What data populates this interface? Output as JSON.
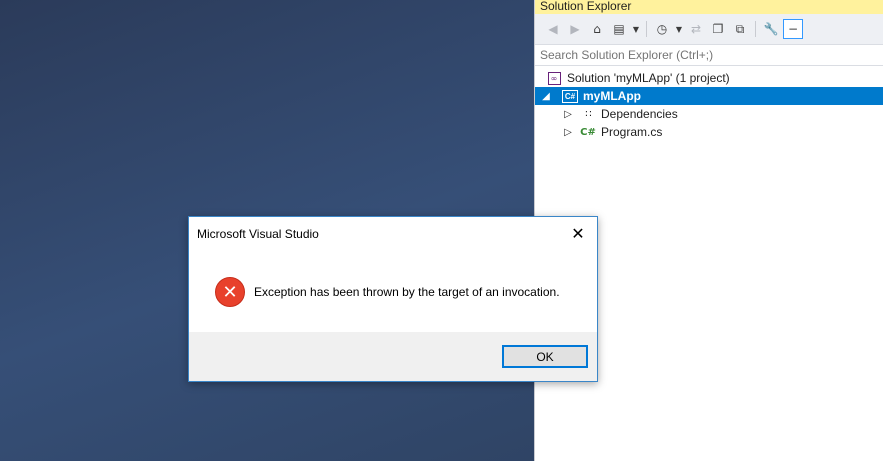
{
  "solution_explorer": {
    "title": "Solution Explorer",
    "search_placeholder": "Search Solution Explorer (Ctrl+;)",
    "tree": {
      "solution_label": "Solution 'myMLApp' (1 project)",
      "project_label": "myMLApp",
      "dependencies_label": "Dependencies",
      "program_label": "Program.cs"
    }
  },
  "dialog": {
    "title": "Microsoft Visual Studio",
    "message": "Exception has been thrown by the target of an invocation.",
    "ok_label": "OK"
  },
  "colors": {
    "selection": "#007acc",
    "error_icon": "#e8412c",
    "dialog_border": "#3a86c8",
    "title_highlight": "#fff29d"
  }
}
